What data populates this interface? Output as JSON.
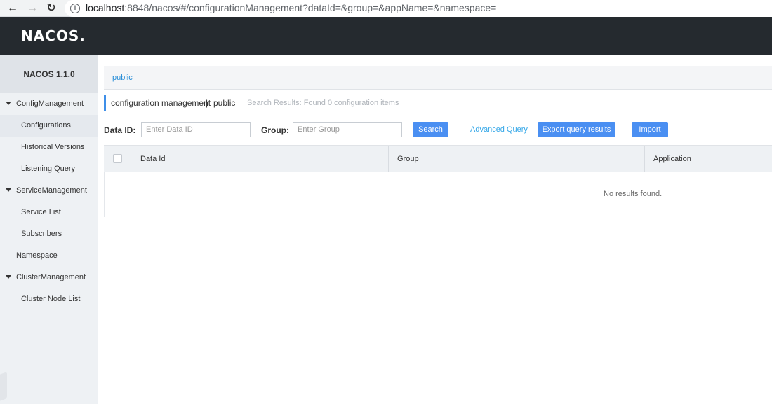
{
  "browser": {
    "back_icon": "arrow-left-icon",
    "forward_icon": "arrow-right-icon",
    "reload_icon": "reload-icon",
    "info_icon": "info-icon",
    "url_host": "localhost",
    "url_rest": ":8848/nacos/#/configurationManagement?dataId=&group=&appName=&namespace="
  },
  "header": {
    "logo": "NACOS."
  },
  "sidebar": {
    "version": "NACOS 1.1.0",
    "groups": [
      {
        "label": "ConfigManagement",
        "items": [
          "Configurations",
          "Historical Versions",
          "Listening Query"
        ]
      },
      {
        "label": "ServiceManagement",
        "items": [
          "Service List",
          "Subscribers"
        ]
      },
      {
        "label": "Namespace"
      },
      {
        "label": "ClusterManagement",
        "items": [
          "Cluster Node List"
        ]
      }
    ],
    "active_item": "Configurations"
  },
  "namespace_bar": {
    "current": "public"
  },
  "page": {
    "title": "configuration management",
    "separator": "|",
    "namespace": "public",
    "search_result": "Search Results: Found 0 configuration items"
  },
  "filters": {
    "data_id_label": "Data ID:",
    "data_id_placeholder": "Enter Data ID",
    "group_label": "Group:",
    "group_placeholder": "Enter Group",
    "search_button": "Search",
    "advanced_query": "Advanced Query",
    "export_button": "Export query results",
    "import_button": "Import"
  },
  "table": {
    "columns": [
      "Data Id",
      "Group",
      "Application"
    ],
    "empty_text": "No results found."
  },
  "colors": {
    "header_bg": "#252a2f",
    "sidebar_bg": "#eef1f4",
    "primary": "#4a8ff2",
    "link": "#34a7e8"
  }
}
